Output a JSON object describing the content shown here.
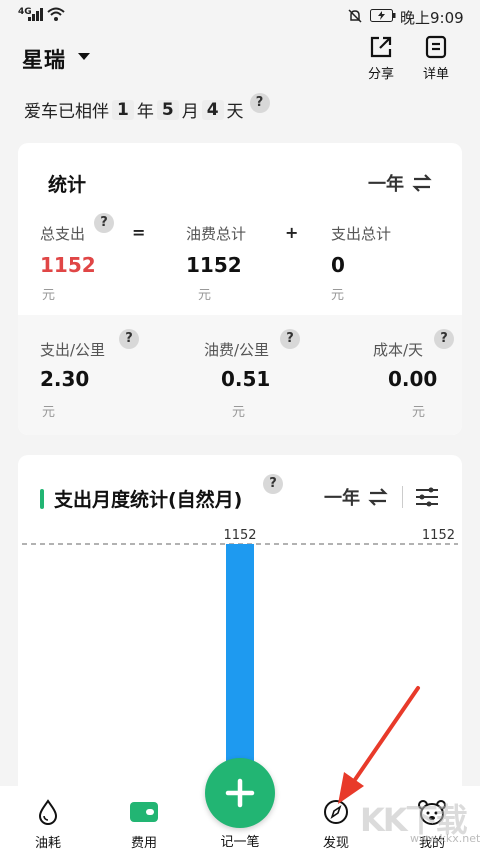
{
  "status_bar": {
    "network": "4G",
    "time": "晚上9:09"
  },
  "header": {
    "car_name": "星瑞",
    "share_label": "分享",
    "detail_label": "详单"
  },
  "companion": {
    "prefix": "爱车已相伴",
    "years": "1",
    "years_unit": "年",
    "months": "5",
    "months_unit": "月",
    "days": "4",
    "days_unit": "天"
  },
  "stats": {
    "title": "统计",
    "period": "一年",
    "total_label": "总支出",
    "total_value": "1152",
    "equals": "=",
    "fuel_label": "油费总计",
    "fuel_value": "1152",
    "plus": "+",
    "expense_label": "支出总计",
    "expense_value": "0",
    "unit": "元",
    "per_km_label": "支出/公里",
    "per_km_value": "2.30",
    "fuel_per_km_label": "油费/公里",
    "fuel_per_km_value": "0.51",
    "cost_per_day_label": "成本/天",
    "cost_per_day_value": "0.00",
    "question": "?"
  },
  "monthly": {
    "title": "支出月度统计(自然月)",
    "period": "一年"
  },
  "chart_data": {
    "type": "bar",
    "values": [
      1152
    ],
    "data_labels": [
      "1152"
    ],
    "reference_line": {
      "value": 1152,
      "label": "1152"
    }
  },
  "nav": {
    "fuel": "油耗",
    "expense": "费用",
    "add": "记一笔",
    "discover": "发现",
    "mine": "我的"
  },
  "watermark": {
    "logo": "KK下载",
    "url": "www.kkx.net"
  },
  "colors": {
    "accent": "#22b573",
    "bar": "#1e9af0",
    "red": "#e04646"
  }
}
